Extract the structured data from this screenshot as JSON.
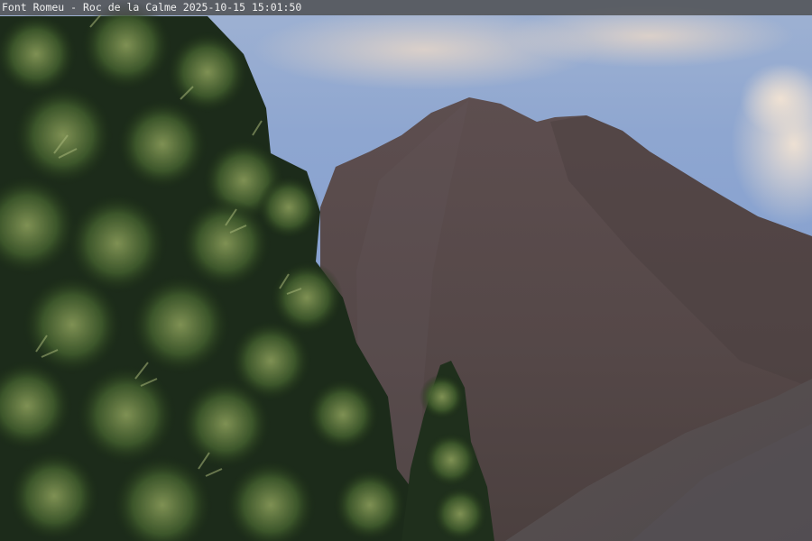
{
  "overlay": {
    "caption": "Font Romeu - Roc de la Calme 2025-10-15 15:01:50"
  }
}
